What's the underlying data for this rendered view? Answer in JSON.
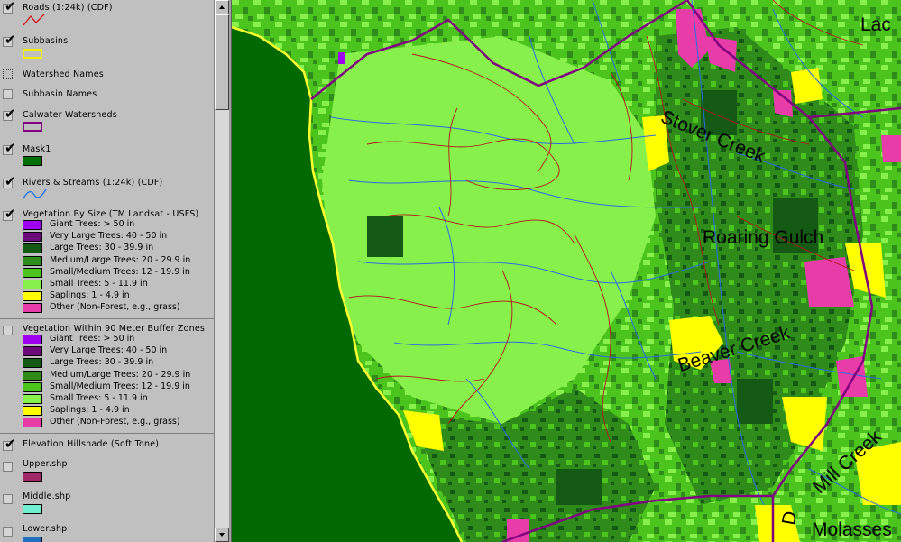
{
  "legend": {
    "layers": [
      {
        "title": "Roads (1:24k) (CDF)",
        "checked": true,
        "symbol": "road-line"
      },
      {
        "title": "Subbasins",
        "checked": true,
        "symbol": "yellow-outline-box"
      },
      {
        "title": "Watershed Names",
        "checked": false,
        "symbol": "none"
      },
      {
        "title": "Subbasin Names",
        "checked": false,
        "symbol": "none"
      },
      {
        "title": "Calwater Watersheds",
        "checked": true,
        "symbol": "purple-outline-box"
      },
      {
        "title": "Mask1",
        "checked": true,
        "symbol": "green-box"
      },
      {
        "title": "Rivers & Streams (1:24k) (CDF)",
        "checked": true,
        "symbol": "stream-line"
      },
      {
        "title": "Vegetation By Size (TM Landsat - USFS)",
        "checked": true,
        "symbol": "classes"
      },
      {
        "title": "Vegetation Within 90 Meter Buffer Zones",
        "checked": false,
        "symbol": "classes"
      },
      {
        "title": "Elevation Hillshade (Soft Tone)",
        "checked": true,
        "symbol": "none"
      },
      {
        "title": "Upper.shp",
        "checked": false,
        "symbol": "maroon-box"
      },
      {
        "title": "Middle.shp",
        "checked": false,
        "symbol": "aqua-box"
      },
      {
        "title": "Lower.shp",
        "checked": false,
        "symbol": "blue-box"
      }
    ],
    "veg_classes": [
      {
        "label": "Giant Trees: > 50 in",
        "color": "#a000f0"
      },
      {
        "label": "Very Large Trees: 40 - 50 in",
        "color": "#6a0a78"
      },
      {
        "label": "Large Trees: 30 - 39.9 in",
        "color": "#145a14"
      },
      {
        "label": "Medium/Large Trees: 20 - 29.9 in",
        "color": "#2f8c1a"
      },
      {
        "label": "Small/Medium Trees: 12 - 19.9 in",
        "color": "#4cc41e"
      },
      {
        "label": "Small Trees: 5 - 11.9 in",
        "color": "#88f04a"
      },
      {
        "label": "Saplings: 1 - 4.9 in",
        "color": "#ffff00"
      },
      {
        "label": "Other (Non-Forest, e.g., grass)",
        "color": "#e83ca8"
      }
    ],
    "swatch_colors": {
      "roads": "#d01010",
      "subbasins": "#f0f000",
      "calwater": "#800080",
      "mask1": "#007000",
      "streams": "#2070e0",
      "upper": "#a02868",
      "middle": "#70f0d0",
      "lower": "#2070c0"
    }
  },
  "map": {
    "labels": [
      {
        "text": "Lac"
      },
      {
        "text": "Stover Creek"
      },
      {
        "text": "Roaring Gulch"
      },
      {
        "text": "Beaver Creek"
      },
      {
        "text": "Mill Creek"
      },
      {
        "text": "Molasses"
      },
      {
        "text": "D"
      }
    ],
    "colors": {
      "mask": "#006a00",
      "coast": "#ffff30",
      "watershed": "#800080",
      "roads": "#b01818",
      "streams": "#2a6ee0"
    }
  }
}
